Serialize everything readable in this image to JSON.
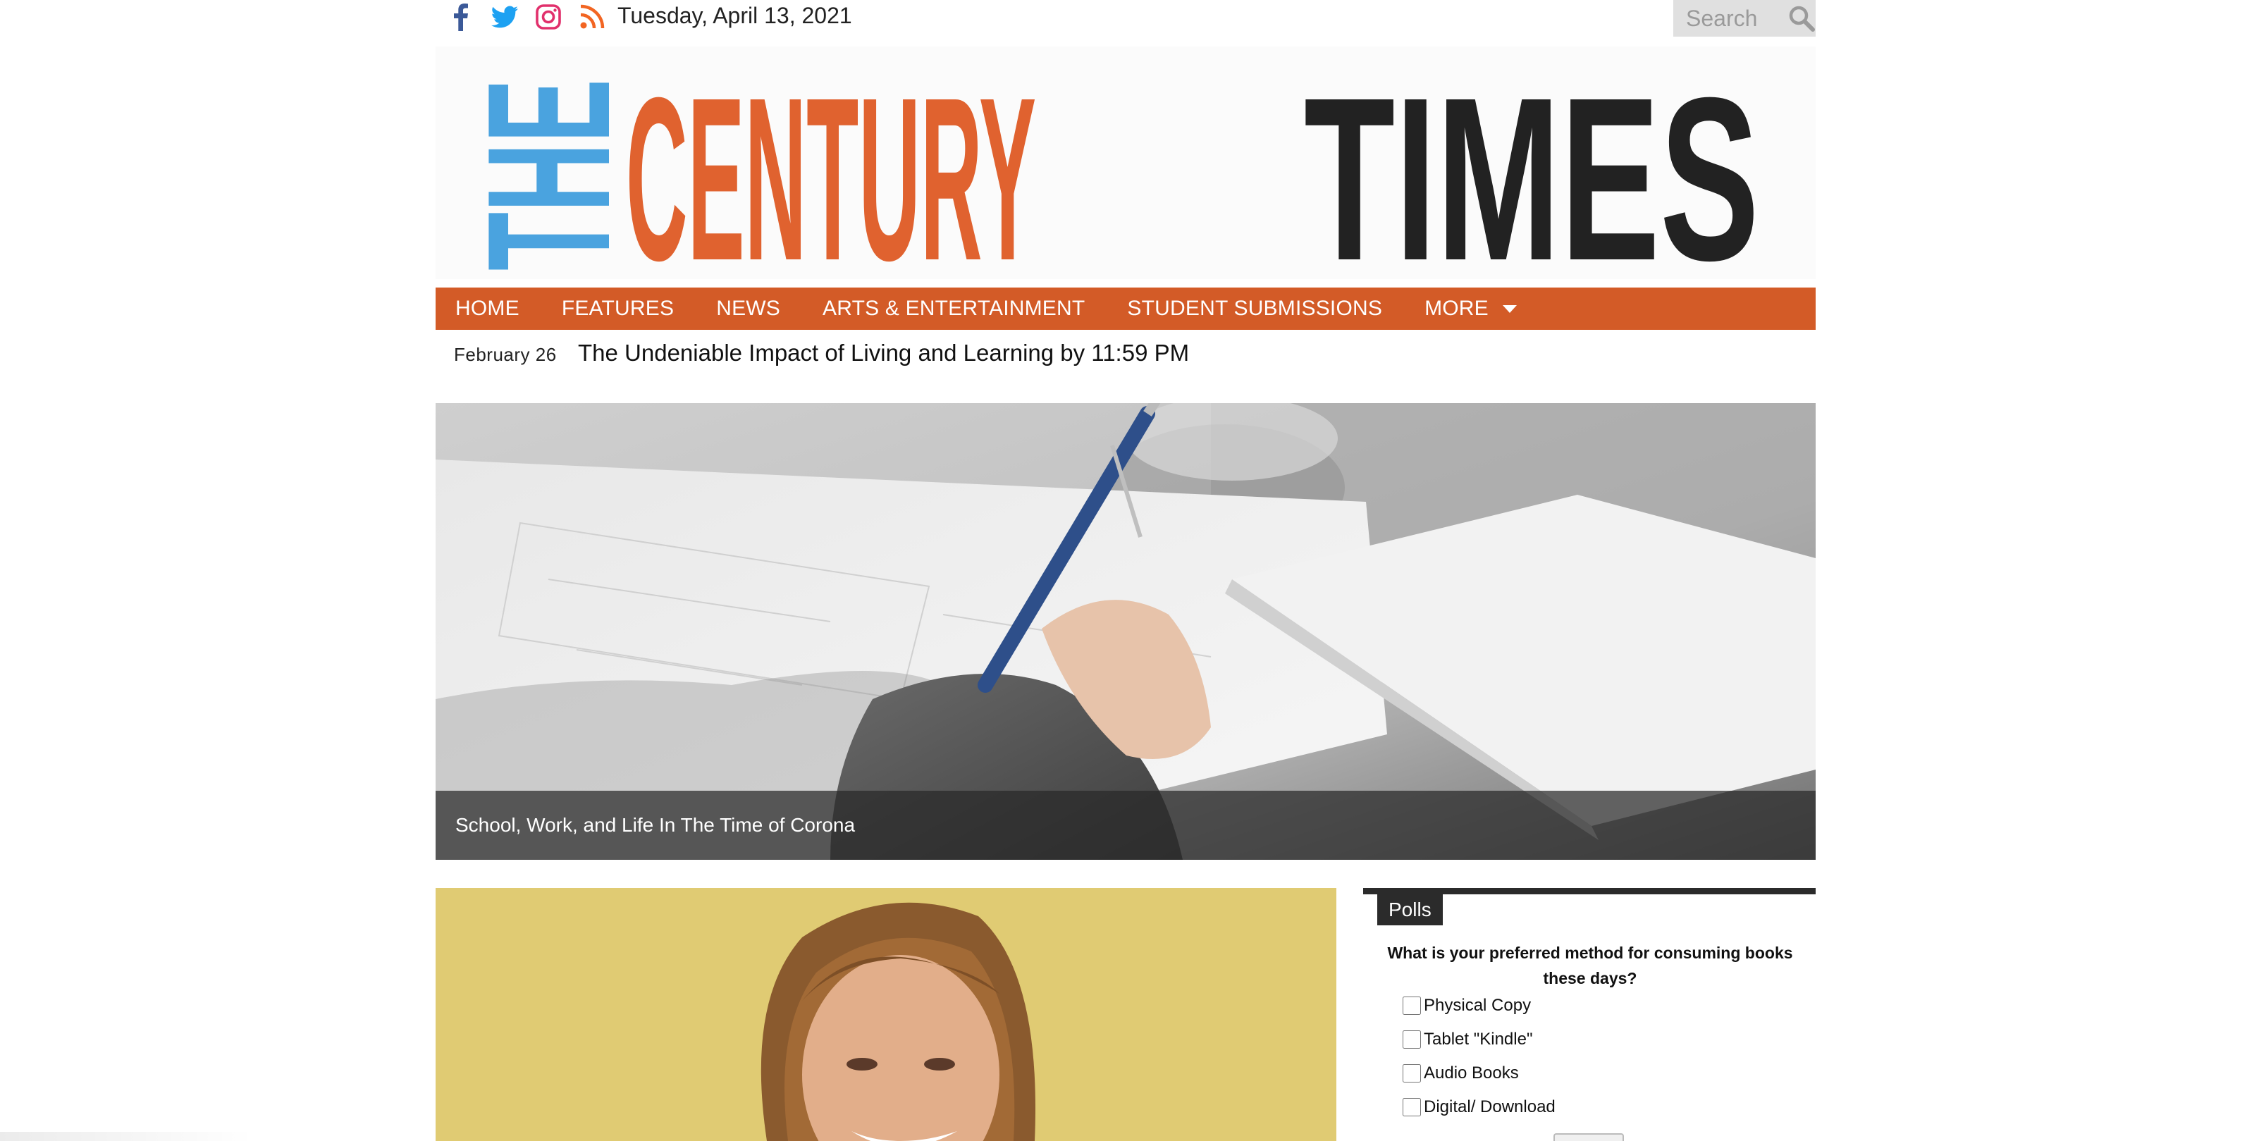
{
  "header": {
    "date": "Tuesday, April 13, 2021",
    "social": [
      {
        "icon": "facebook-icon",
        "color": "#3b5998"
      },
      {
        "icon": "twitter-icon",
        "color": "#1da1f2"
      },
      {
        "icon": "instagram-icon",
        "color": "#e1306c"
      },
      {
        "icon": "rss-icon",
        "color": "#f26522"
      }
    ],
    "search": {
      "placeholder": "Search",
      "icon": "search-icon"
    }
  },
  "masthead": {
    "word_the": "THE",
    "word_century": "CENTURY",
    "word_times": "TIMES",
    "colors": {
      "the": "#4aa3df",
      "century": "#e0622f",
      "times": "#222222"
    }
  },
  "nav": {
    "items": [
      "HOME",
      "FEATURES",
      "NEWS",
      "ARTS & ENTERTAINMENT",
      "STUDENT SUBMISSIONS",
      "MORE"
    ],
    "more_icon": "caret-down-icon",
    "color": "#d35b27"
  },
  "ticker": {
    "date": "February  26",
    "headline": "The Undeniable Impact of Living and Learning by 11:59 PM"
  },
  "hero": {
    "caption": "School, Work, and Life In The Time of Corona"
  },
  "polls": {
    "title": "Polls",
    "question": "What is your preferred method for consuming books these days?",
    "options": [
      "Physical Copy",
      "Tablet \"Kindle\"",
      "Audio Books",
      "Digital/ Download"
    ]
  }
}
